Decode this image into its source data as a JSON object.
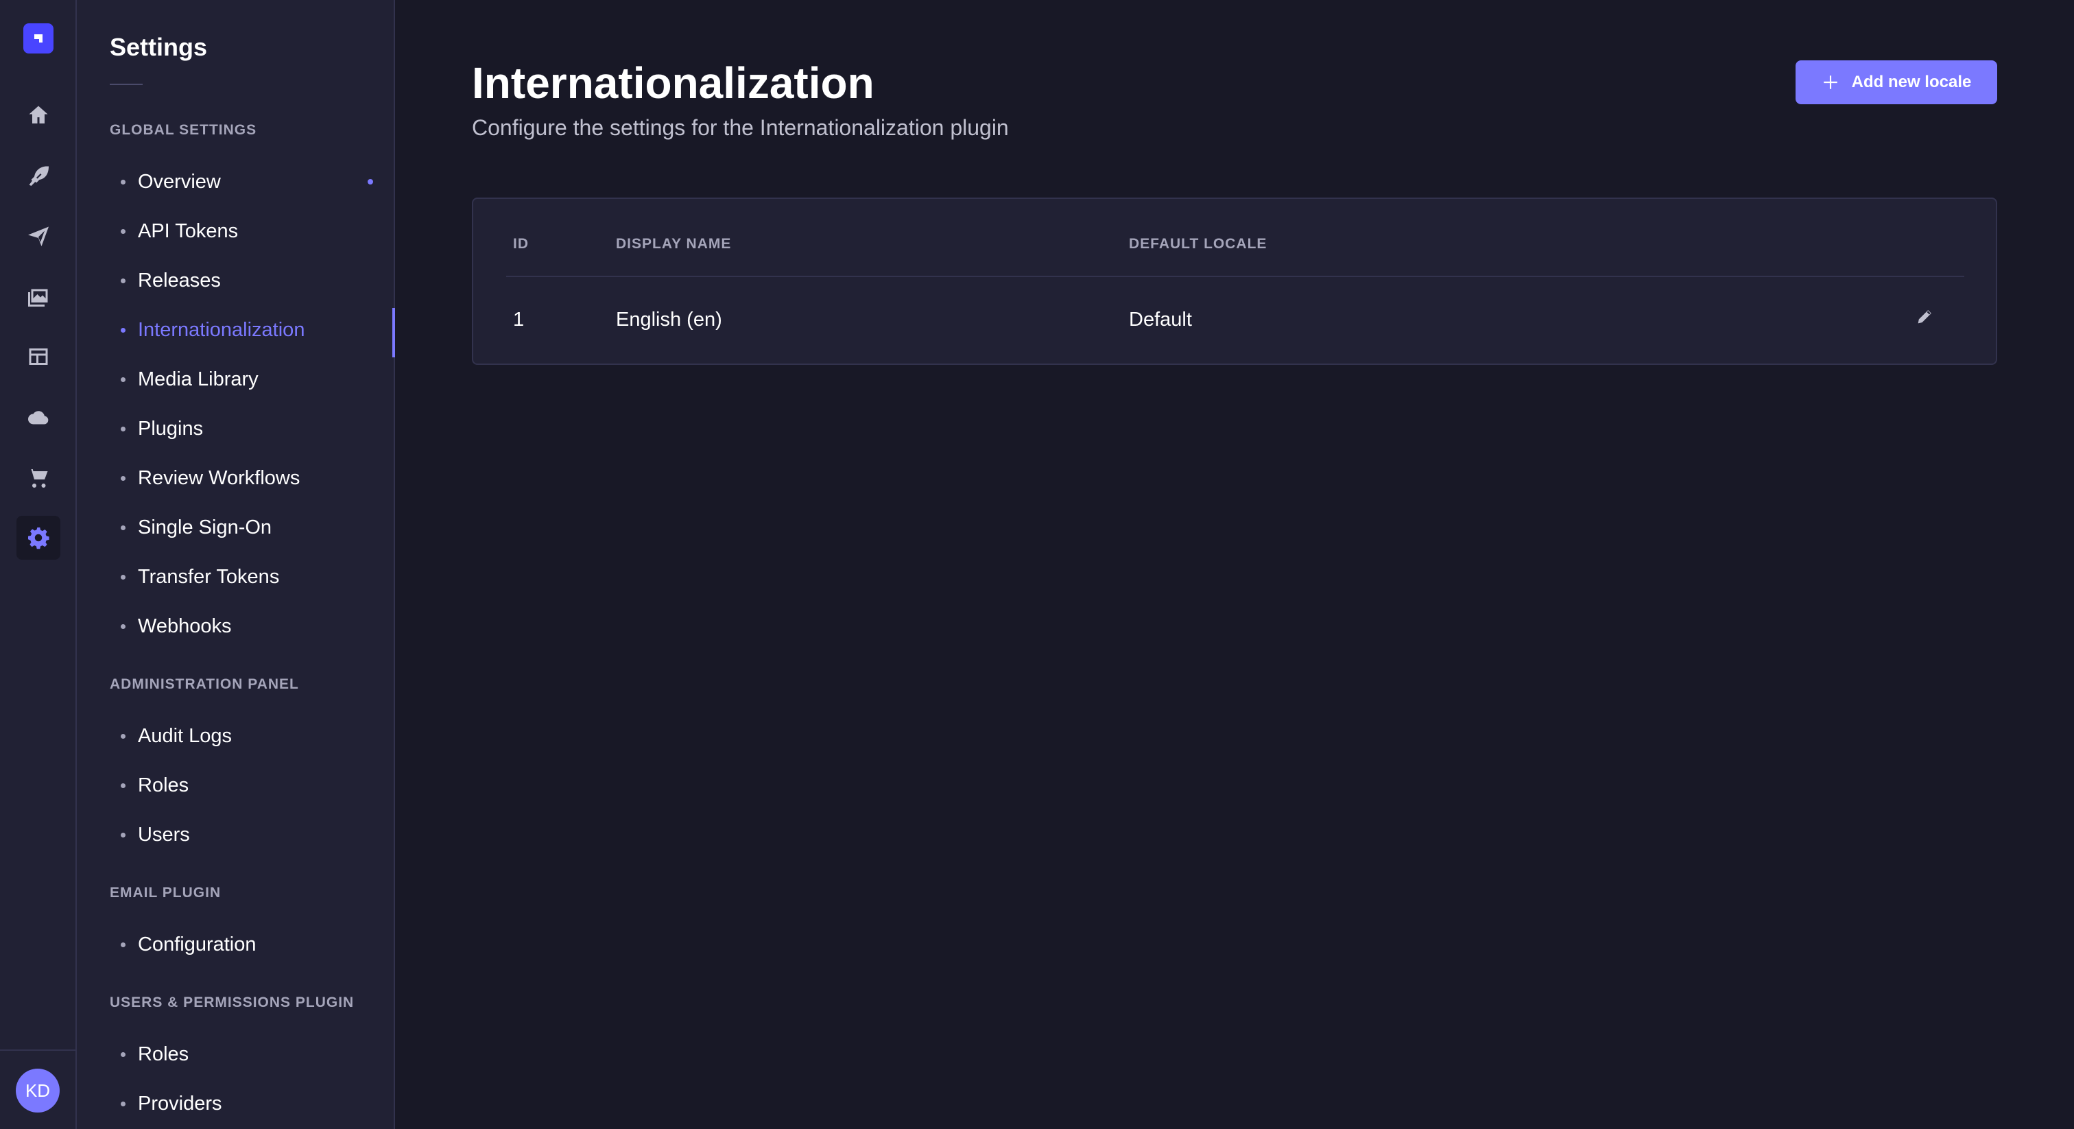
{
  "sidebar_rail": {
    "logo_icon": "strapi-logo-icon",
    "items": [
      {
        "name": "home-icon",
        "active": false
      },
      {
        "name": "content-manager-icon",
        "active": false
      },
      {
        "name": "releases-icon",
        "active": false
      },
      {
        "name": "media-library-icon",
        "active": false
      },
      {
        "name": "content-type-builder-icon",
        "active": false
      },
      {
        "name": "cloud-icon",
        "active": false
      },
      {
        "name": "marketplace-icon",
        "active": false
      },
      {
        "name": "settings-icon",
        "active": true
      }
    ],
    "avatar_initials": "KD"
  },
  "settings_nav": {
    "title": "Settings",
    "sections": [
      {
        "label": "Global Settings",
        "items": [
          {
            "label": "Overview",
            "active": false,
            "new_dot": true
          },
          {
            "label": "API Tokens",
            "active": false
          },
          {
            "label": "Releases",
            "active": false
          },
          {
            "label": "Internationalization",
            "active": true
          },
          {
            "label": "Media Library",
            "active": false
          },
          {
            "label": "Plugins",
            "active": false
          },
          {
            "label": "Review Workflows",
            "active": false
          },
          {
            "label": "Single Sign-On",
            "active": false
          },
          {
            "label": "Transfer Tokens",
            "active": false
          },
          {
            "label": "Webhooks",
            "active": false
          }
        ]
      },
      {
        "label": "Administration Panel",
        "items": [
          {
            "label": "Audit Logs",
            "active": false
          },
          {
            "label": "Roles",
            "active": false
          },
          {
            "label": "Users",
            "active": false
          }
        ]
      },
      {
        "label": "Email Plugin",
        "items": [
          {
            "label": "Configuration",
            "active": false
          }
        ]
      },
      {
        "label": "Users & Permissions Plugin",
        "items": [
          {
            "label": "Roles",
            "active": false
          },
          {
            "label": "Providers",
            "active": false
          }
        ]
      }
    ]
  },
  "main": {
    "title": "Internationalization",
    "subtitle": "Configure the settings for the Internationalization plugin",
    "add_button_label": "Add new locale",
    "table": {
      "headers": [
        "ID",
        "Display name",
        "Default locale"
      ],
      "rows": [
        {
          "id": "1",
          "display_name": "English (en)",
          "default_locale": "Default"
        }
      ]
    }
  },
  "colors": {
    "background": "#181826",
    "panel": "#212134",
    "border": "#32324d",
    "accent": "#7b79ff",
    "brand": "#4945ff",
    "muted_text": "#a5a5ba"
  }
}
